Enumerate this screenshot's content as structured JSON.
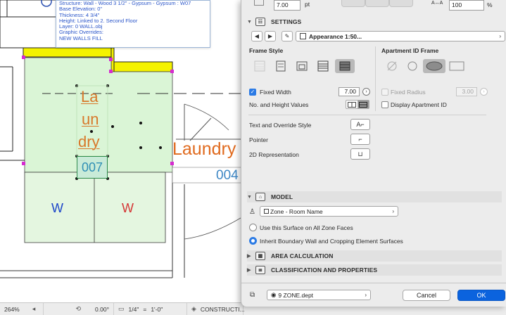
{
  "tooltip": {
    "lines": [
      "Structure: Wall - Wood 3 1/2\" - Gypsum - Gypsum : W07",
      "Base Elevation: 0\"",
      "Thickness: 4 3/4\"",
      "Height: Linked to 2. Second Floor",
      "Layer: 0 WALL.obj",
      "Graphic Overrides:",
      "NEW WALLS FILL"
    ]
  },
  "plan": {
    "zone_name_lines": [
      "La",
      "un",
      "dry"
    ],
    "zone_number": "007",
    "ext_zone_name": "Laundry",
    "ext_zone_number": "004",
    "w_left": "W",
    "w_right": "W"
  },
  "status_bar": {
    "zoom": "264%",
    "angle": "0.00°",
    "scale_left": "1/4\"",
    "scale_eq": "=",
    "scale_right": "1'-0\"",
    "layer_combo": "CONSTRUCTI..."
  },
  "dialog": {
    "top": {
      "value_field_1": "7.00",
      "unit_1": "pt",
      "value_field_2": "100",
      "unit_2": "%"
    },
    "settings": {
      "title": "SETTINGS",
      "favorites_label": "Appearance 1:50...",
      "frame_style_title": "Frame Style",
      "apartment_id_title": "Apartment ID Frame",
      "fixed_width_label": "Fixed Width",
      "fixed_width_checked": true,
      "fixed_width_value": "7.00",
      "fixed_radius_label": "Fixed Radius",
      "fixed_radius_checked": false,
      "fixed_radius_value": "3.00",
      "no_height_label": "No. and Height Values",
      "display_apartment_label": "Display Apartment ID",
      "display_apartment_checked": false,
      "text_override_label": "Text and Override Style",
      "pointer_label": "Pointer",
      "representation_label": "2D Representation"
    },
    "model": {
      "title": "MODEL",
      "surface_popup": "Zone - Room Name",
      "radio_option_1": "Use this Surface on All Zone Faces",
      "radio_option_2": "Inherit Boundary Wall and Cropping Element Surfaces",
      "selected_option": 2
    },
    "area_calculation": {
      "title": "AREA CALCULATION"
    },
    "classification": {
      "title": "CLASSIFICATION AND PROPERTIES"
    },
    "footer": {
      "layer_popup": "9 ZONE.dept",
      "cancel_label": "Cancel",
      "ok_label": "OK"
    }
  },
  "colors": {
    "zone_fill": "#daf5d6",
    "zone_text": "#d8782a",
    "wall_yellow": "#f4f200",
    "accent_blue": "#0b63de",
    "handle_magenta": "#d62bd0"
  }
}
